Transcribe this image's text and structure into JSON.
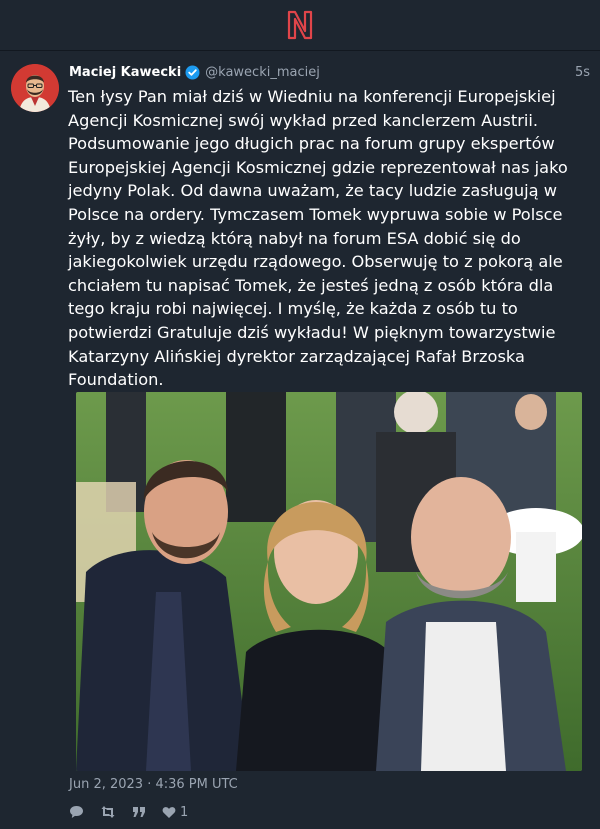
{
  "app": {
    "logo_icon": "nitter-n-logo",
    "accent_color": "#e0454a"
  },
  "tweet": {
    "author_name": "Maciej Kawecki",
    "verified": true,
    "handle": "@kawecki_maciej",
    "relative_time": "5s",
    "text": "Ten łysy Pan miał dziś w Wiedniu na konferencji Europejskiej Agencji Kosmicznej swój wykład przed kanclerzem Austrii. Podsumowanie jego długich prac na forum grupy ekspertów Europejskiej Agencji Kosmicznej gdzie reprezentował nas jako jedyny Polak. Od dawna uważam, że tacy ludzie zasługują w Polsce na ordery. Tymczasem Tomek wypruwa sobie w Polsce żyły, by z wiedzą którą nabył na forum ESA dobić się do jakiegokolwiek urzędu rządowego. Obserwuję to z pokorą ale chciałem tu napisać Tomek, że jesteś jedną z osób która dla tego kraju robi najwięcej. I myślę, że każda z osób tu to potwierdzi    Gratuluje dziś wykładu! W pięknym towarzystwie Katarzyny Alińskiej dyrektor zarządzającej Rafał Brzoska Foundation.",
    "date": "Jun 2, 2023 · 4:36 PM UTC",
    "stats": {
      "replies": "",
      "retweets": "",
      "quotes": "",
      "likes": "1"
    },
    "icons": {
      "reply": "comment-icon",
      "retweet": "retweet-icon",
      "quote": "quote-icon",
      "like": "heart-icon"
    }
  }
}
